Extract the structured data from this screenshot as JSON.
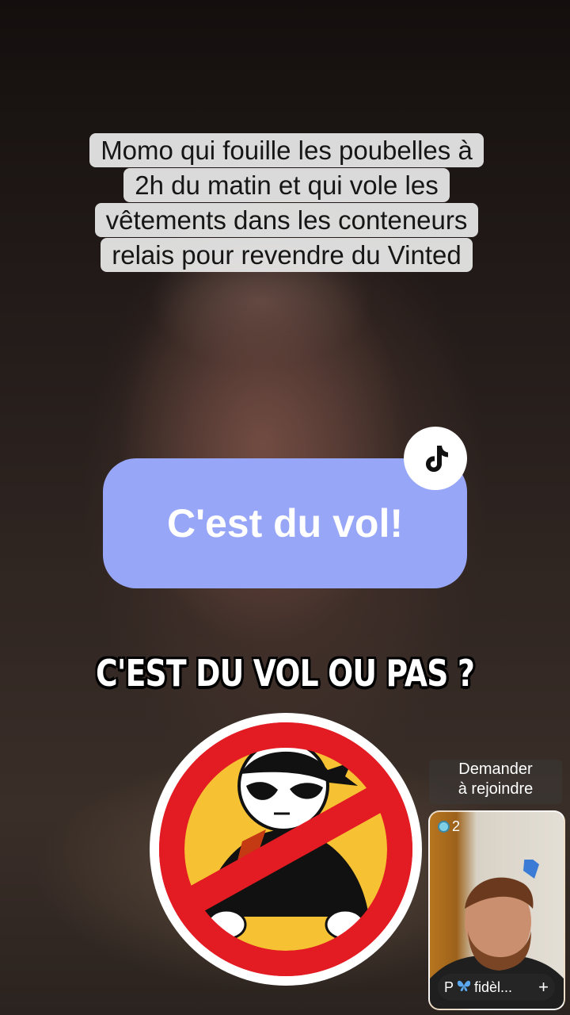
{
  "caption": {
    "lines": [
      "Momo qui fouille les poubelles à",
      "2h du matin et qui vole les",
      "vêtements dans les conteneurs",
      "relais pour revendre du Vinted"
    ]
  },
  "bubble": {
    "text": "C'est du vol!"
  },
  "headline": {
    "text": "C'EST DU VOL OU PAS ?"
  },
  "join_button": {
    "label_line1": "Demander",
    "label_line2": "à rejoindre"
  },
  "pip": {
    "viewer_count": "2",
    "tag_prefix": "P",
    "tag_text": "fidèl...",
    "tag_action": "+"
  },
  "colors": {
    "bubble": "#98a6f7",
    "sign_red": "#e31b23",
    "sign_yellow": "#f6c233"
  },
  "icons": [
    "tiktok-logo-icon",
    "no-thief-sign-icon",
    "butterfly-icon",
    "plus-icon"
  ]
}
